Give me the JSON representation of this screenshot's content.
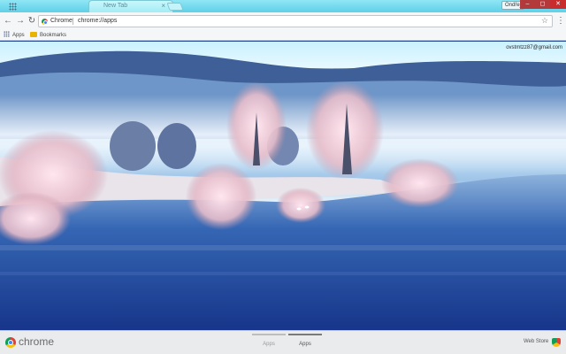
{
  "window": {
    "tab_title": "New Tab",
    "tab_close": "×",
    "profile_name": "Ondřej",
    "min_glyph": "–",
    "max_glyph": "◻",
    "close_glyph": "✕"
  },
  "toolbar": {
    "back_glyph": "←",
    "forward_glyph": "→",
    "reload_glyph": "↻",
    "chip_label": "Chrome",
    "url": "chrome://apps",
    "star_glyph": "☆",
    "menu_glyph": "⋮"
  },
  "bookmarks": {
    "apps_label": "Apps",
    "folder_label": "Bookmarks"
  },
  "ntp": {
    "account_email": "ovstmtzz87@gmail.com"
  },
  "bottom": {
    "logo_text": "chrome",
    "pages": [
      {
        "label": "Apps",
        "active": false
      },
      {
        "label": "Apps",
        "active": true
      }
    ],
    "webstore_label": "Web Store"
  },
  "icons": {
    "apps_grid": "grid-icon",
    "folder": "folder-icon",
    "chrome_logo": "chrome-logo-icon",
    "webstore": "webstore-icon"
  },
  "colors": {
    "tabstrip": "#6fd8ec",
    "window_close": "#c92c2c",
    "toolbar": "#f5f6f7",
    "bottombar": "#e9ebed"
  }
}
